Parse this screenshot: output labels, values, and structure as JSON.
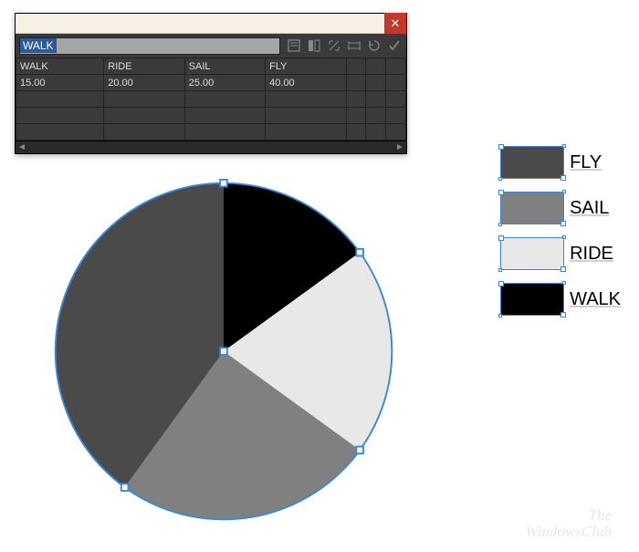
{
  "panel": {
    "entry_value": "WALK",
    "headers": [
      "WALK",
      "RIDE",
      "SAIL",
      "FLY"
    ],
    "row1": [
      "15.00",
      "20.00",
      "25.00",
      "40.00"
    ]
  },
  "legend": {
    "items": [
      {
        "label": "FLY",
        "color": "#4a4a4a"
      },
      {
        "label": "SAIL",
        "color": "#808080"
      },
      {
        "label": "RIDE",
        "color": "#e8e8e8"
      },
      {
        "label": "WALK",
        "color": "#000000"
      }
    ]
  },
  "watermark": {
    "line1": "The",
    "line2": "WindowsClub"
  },
  "chart_data": {
    "type": "pie",
    "title": "",
    "categories": [
      "WALK",
      "RIDE",
      "SAIL",
      "FLY"
    ],
    "values": [
      15.0,
      20.0,
      25.0,
      40.0
    ],
    "colors": {
      "WALK": "#000000",
      "RIDE": "#e8e8e8",
      "SAIL": "#808080",
      "FLY": "#4a4a4a"
    }
  }
}
